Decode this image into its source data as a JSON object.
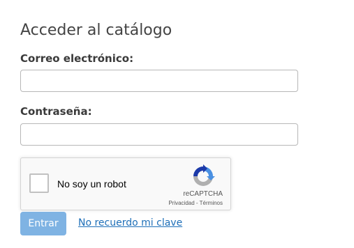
{
  "page": {
    "title": "Acceder al catálogo"
  },
  "form": {
    "email_label": "Correo electrónico:",
    "email_value": "",
    "password_label": "Contraseña:",
    "password_value": ""
  },
  "recaptcha": {
    "checkbox_label": "No soy un robot",
    "brand": "reCAPTCHA",
    "privacy_link": "Privacidad",
    "separator": " - ",
    "terms_link": "Términos",
    "logo_icon": "recaptcha-logo-icon"
  },
  "actions": {
    "submit_label": "Entrar",
    "forgot_label": "No recuerdo mi clave"
  },
  "colors": {
    "submit_button": "#7fb3e3",
    "link": "#1e6fb8",
    "recaptcha_blue": "#1c3aa9",
    "recaptcha_light_blue": "#4a90e2",
    "recaptcha_gray": "#b0b0b0"
  }
}
